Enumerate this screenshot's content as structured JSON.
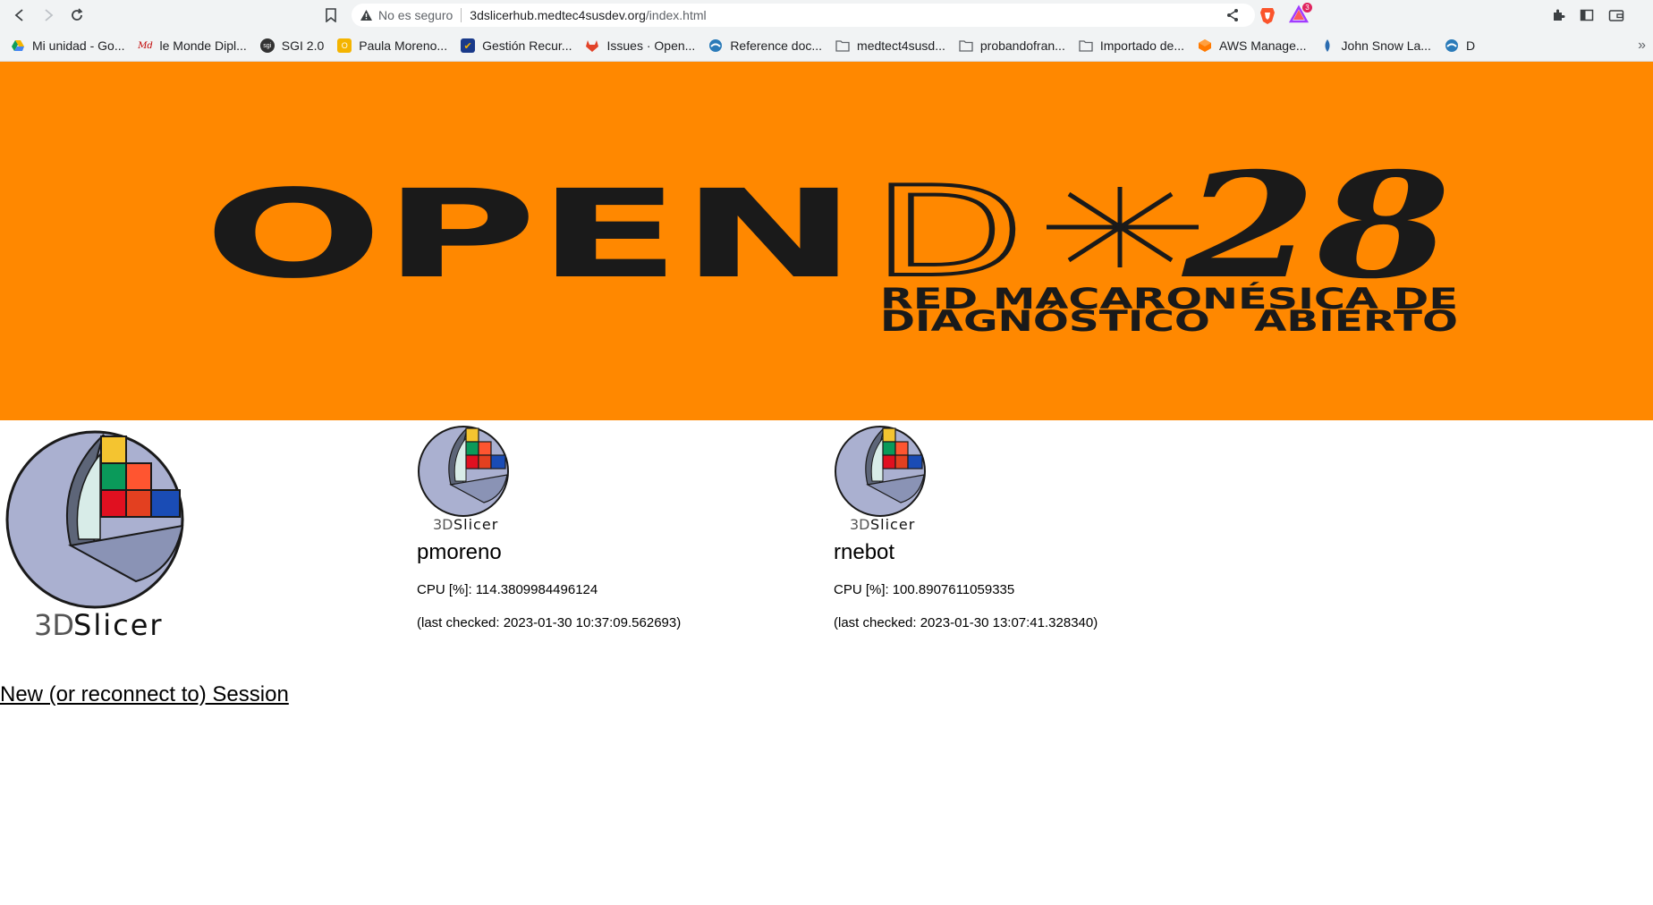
{
  "browser": {
    "insecure_label": "No es seguro",
    "url_host": "3dslicerhub.medtec4susdev.org",
    "url_path": "/index.html",
    "alert_count": "3",
    "bookmarks": [
      {
        "label": "Mi unidad - Go...",
        "icon": "drive-icon",
        "color": "#1fa463"
      },
      {
        "label": "le Monde Dipl...",
        "icon": "md-icon",
        "color": "#c00000"
      },
      {
        "label": "SGI 2.0",
        "icon": "sgi-icon",
        "color": "#333333"
      },
      {
        "label": "Paula Moreno...",
        "icon": "calendar-icon",
        "color": "#f4b400"
      },
      {
        "label": "Gestión Recur...",
        "icon": "check-icon",
        "color": "#1a3a8a"
      },
      {
        "label": "Issues · Open...",
        "icon": "gitlab-icon",
        "color": "#e24329"
      },
      {
        "label": "Reference doc...",
        "icon": "docs-icon",
        "color": "#2b7bb9"
      },
      {
        "label": "medtect4susd...",
        "icon": "folder-icon",
        "color": "#888888"
      },
      {
        "label": "probandofran...",
        "icon": "folder-icon",
        "color": "#888888"
      },
      {
        "label": "Importado de...",
        "icon": "folder-icon",
        "color": "#888888"
      },
      {
        "label": "AWS Manage...",
        "icon": "aws-icon",
        "color": "#ff7a00"
      },
      {
        "label": "John Snow La...",
        "icon": "jsl-icon",
        "color": "#2b6cb0"
      },
      {
        "label": "D",
        "icon": "docs-icon",
        "color": "#2b7bb9"
      }
    ]
  },
  "banner": {
    "brand_open": "OPEN",
    "brand_d": "D",
    "brand_star": "✳",
    "brand_num": "28",
    "subtitle_line1": "RED MACARONÉSICA DE",
    "subtitle_line2": "DIAGNÓSTICO   ABIERTO",
    "color": "#ff8800"
  },
  "logo": {
    "text_3d": "3D",
    "text_slicer": "Slicer"
  },
  "sessions": [
    {
      "user": "pmoreno",
      "cpu_label": "CPU [%]:",
      "cpu_value": "114.3809984496124",
      "checked": "(last checked: 2023-01-30 10:37:09.562693)"
    },
    {
      "user": "rnebot",
      "cpu_label": "CPU [%]:",
      "cpu_value": "100.8907611059335",
      "checked": "(last checked: 2023-01-30 13:07:41.328340)"
    }
  ],
  "new_session_link": "New (or reconnect to) Session"
}
